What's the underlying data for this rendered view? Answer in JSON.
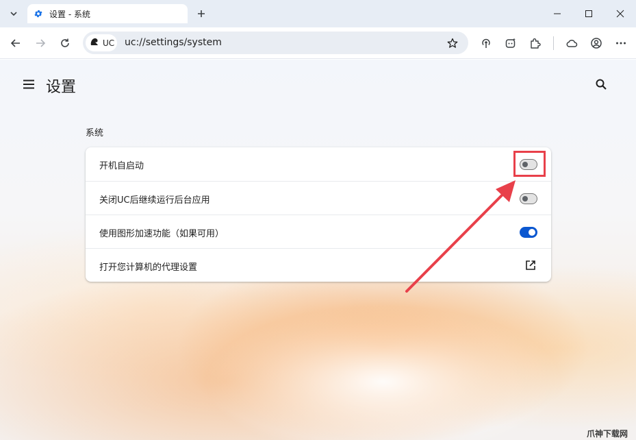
{
  "tab": {
    "title": "设置 - 系统",
    "favicon": "gear-icon"
  },
  "toolbar": {
    "url": "uc://settings/system",
    "site_chip_label": "UC"
  },
  "page": {
    "title": "设置",
    "section_title": "系统"
  },
  "settings": [
    {
      "label": "开机自启动",
      "control": "toggle",
      "state": "off"
    },
    {
      "label": "关闭UC后继续运行后台应用",
      "control": "toggle",
      "state": "off"
    },
    {
      "label": "使用图形加速功能（如果可用）",
      "control": "toggle",
      "state": "on"
    },
    {
      "label": "打开您计算机的代理设置",
      "control": "external-link",
      "state": null
    }
  ],
  "annotation": {
    "highlight_color": "#e8404a",
    "target": "开机自启动 toggle"
  },
  "watermark": "爪神下载网",
  "colors": {
    "accent": "#0b57d0",
    "tabstrip": "#e7edf5",
    "annotation": "#e8404a"
  }
}
